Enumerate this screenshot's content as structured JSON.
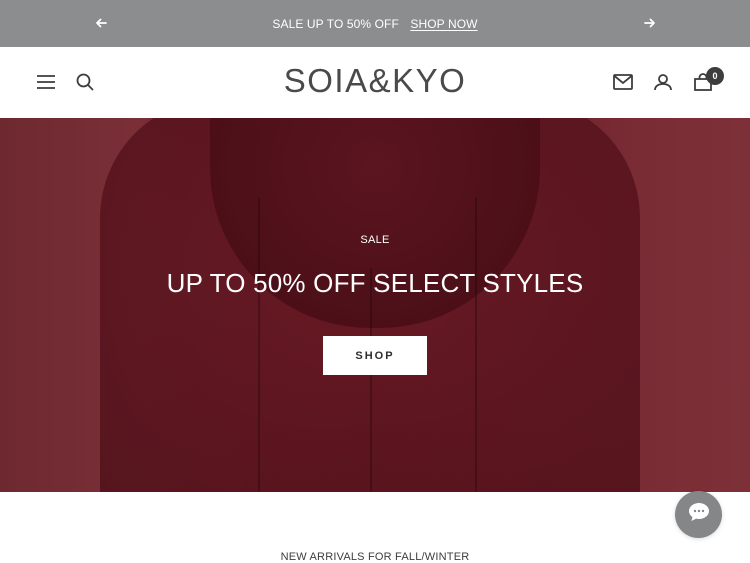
{
  "announcement": {
    "promo_text": "SALE UP TO 50% OFF",
    "link_text": "SHOP NOW",
    "prev_icon": "arrow-left-icon",
    "next_icon": "arrow-right-icon"
  },
  "header": {
    "logo": "SOIA&KYO",
    "cart_count": "0",
    "icons": [
      "menu-icon",
      "search-icon",
      "mail-icon",
      "account-icon",
      "cart-icon"
    ]
  },
  "hero": {
    "label": "SALE",
    "title": "UP TO 50% OFF SELECT STYLES",
    "button": "SHOP"
  },
  "section": {
    "title": "NEW ARRIVALS FOR FALL/WINTER"
  },
  "chat": {
    "icon": "chat-icon"
  },
  "colors": {
    "announcement_bg": "#8c8d8f",
    "hero_bg": "#6a1d27",
    "text_dark": "#3d3d3d"
  }
}
